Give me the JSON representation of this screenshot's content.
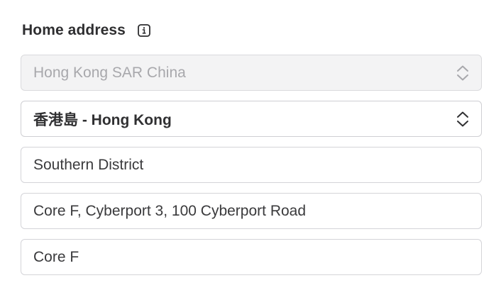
{
  "address": {
    "label": "Home address",
    "country": "Hong Kong SAR China",
    "region": "香港島 - Hong Kong",
    "district": "Southern District",
    "street": "Core F, Cyberport 3, 100 Cyberport Road",
    "unit": "Core F"
  },
  "icons": {
    "info": "info-icon",
    "select_chevron": "chevron-up-down-icon"
  },
  "colors": {
    "label_text": "#2e2e30",
    "border": "#d4d4d8",
    "disabled_bg": "#f3f3f4",
    "disabled_text": "#a8a8ac"
  }
}
